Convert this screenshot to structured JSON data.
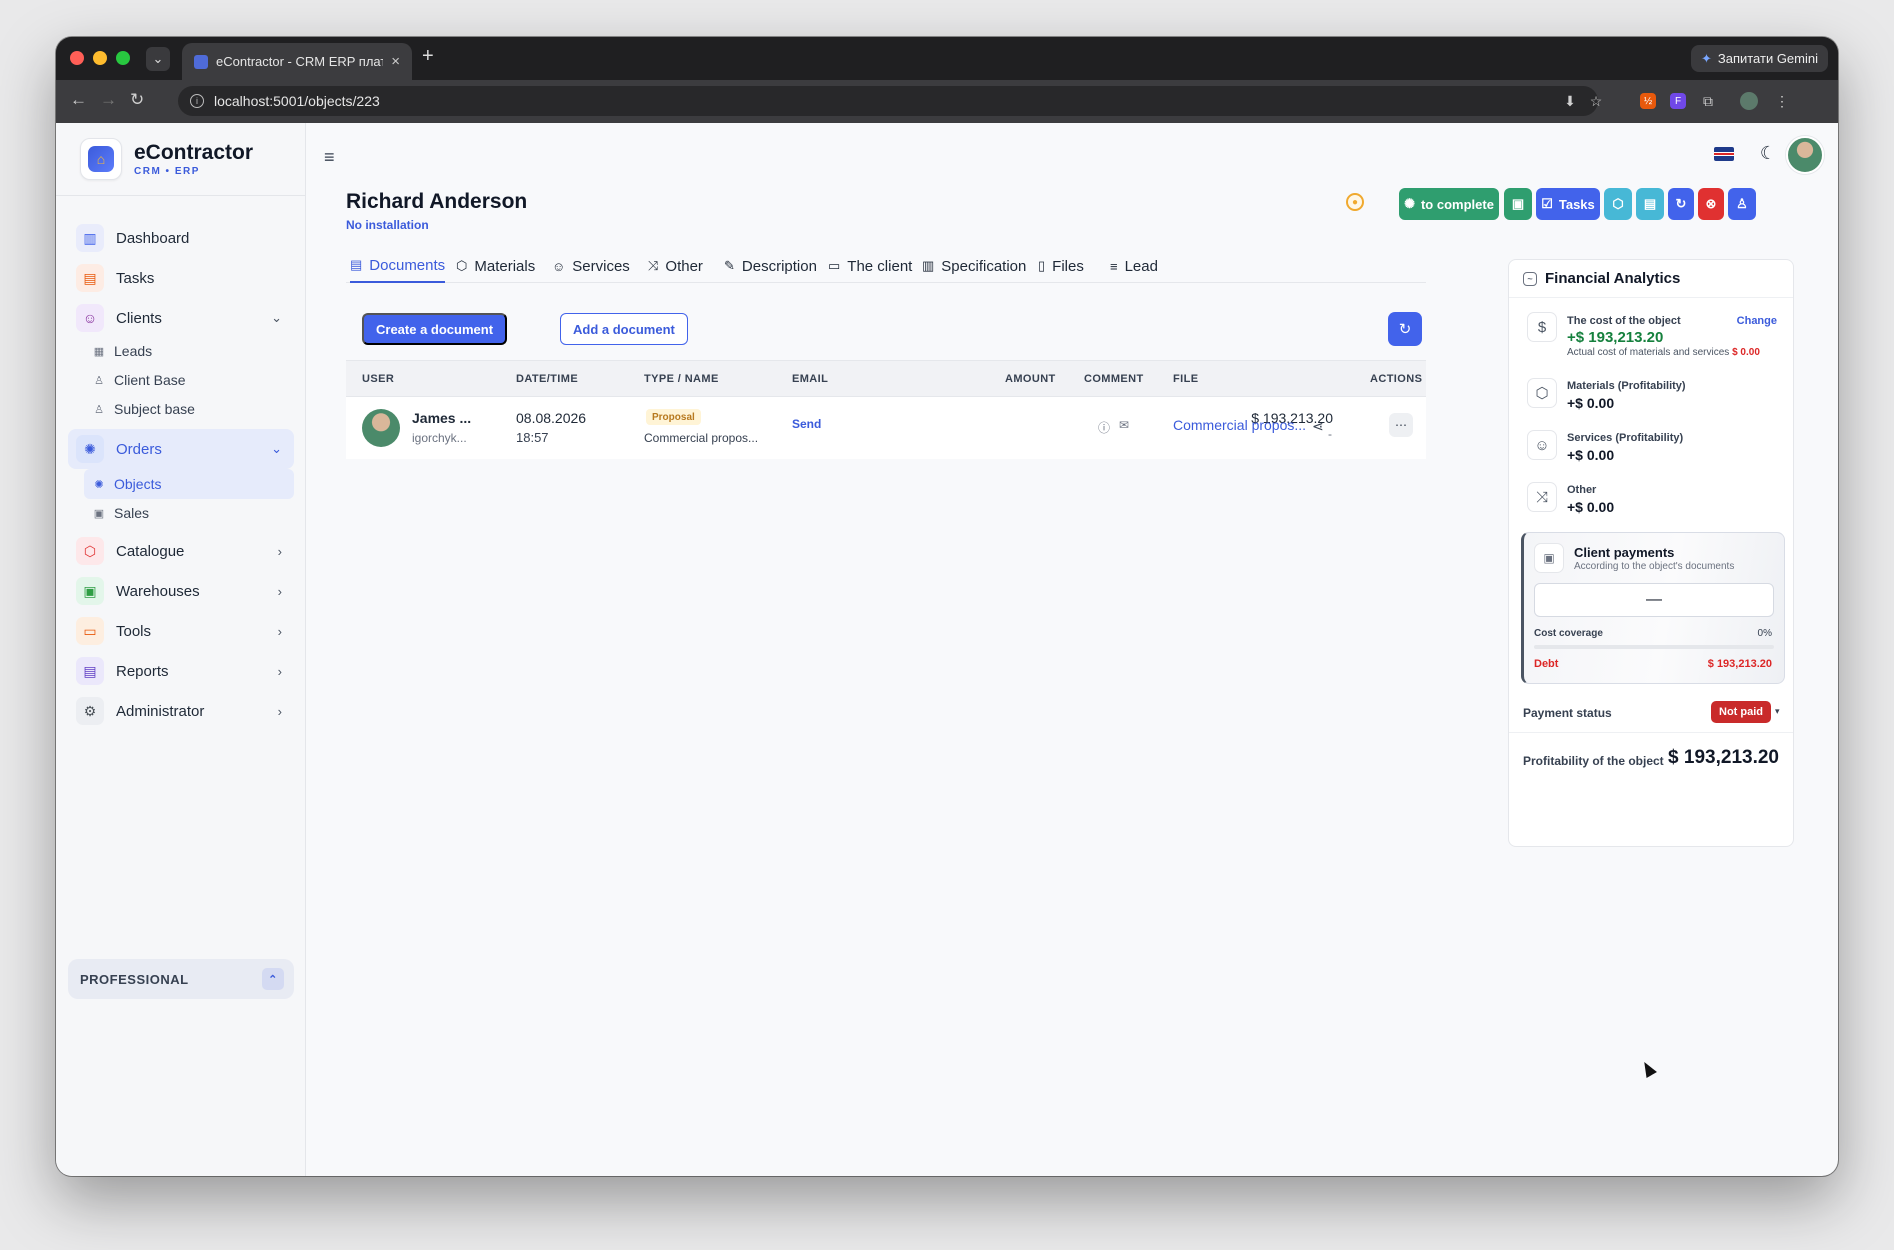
{
  "browser": {
    "tab_title": "eContractor - CRM ERP плат…",
    "url": "localhost:5001/objects/223",
    "gemini_label": "Запитати Gemini"
  },
  "brand": {
    "name": "eContractor",
    "sub": "CRM • ERP"
  },
  "sidebar": {
    "items": {
      "dashboard": "Dashboard",
      "tasks": "Tasks",
      "clients": "Clients",
      "leads": "Leads",
      "client_base": "Client Base",
      "subject_base": "Subject base",
      "orders": "Orders",
      "objects": "Objects",
      "sales": "Sales",
      "catalogue": "Catalogue",
      "warehouses": "Warehouses",
      "tools": "Tools",
      "reports": "Reports",
      "administrator": "Administrator"
    },
    "plan": "PROFESSIONAL"
  },
  "header": {
    "title": "Richard Anderson",
    "subtitle": "No installation",
    "complete_label": "to complete",
    "tasks_label": "Tasks"
  },
  "tabs": {
    "documents": "Documents",
    "materials": "Materials",
    "services": "Services",
    "other": "Other",
    "description": "Description",
    "client": "The client",
    "specification": "Specification",
    "files": "Files",
    "lead": "Lead"
  },
  "toolbar": {
    "create_label": "Create a document",
    "add_label": "Add a document"
  },
  "table": {
    "headers": {
      "user": "USER",
      "datetime": "DATE/TIME",
      "type": "TYPE / NAME",
      "email": "EMAIL",
      "amount": "AMOUNT",
      "comment": "COMMENT",
      "file": "FILE",
      "actions": "ACTIONS"
    },
    "row": {
      "user_name": "James ...",
      "user_email": "igorchyk...",
      "date": "08.08.2026",
      "time": "18:57",
      "badge": "Proposal",
      "doc_name": "Commercial propos...",
      "email_action": "Send",
      "amount": "$ 193,213.20",
      "amount_sub": "-",
      "file_name": "Commercial propos..."
    }
  },
  "financial": {
    "title": "Financial Analytics",
    "cost_label": "The cost of the object",
    "cost_value": "+$ 193,213.20",
    "change_label": "Change",
    "cost_note": "Actual cost of materials and services",
    "cost_note_value": "$ 0.00",
    "materials_label": "Materials (Profitability)",
    "materials_value": "+$ 0.00",
    "services_label": "Services (Profitability)",
    "services_value": "+$ 0.00",
    "other_label": "Other",
    "other_value": "+$ 0.00",
    "client_payments": {
      "title": "Client payments",
      "subtitle": "According to the object's documents",
      "value": "—",
      "coverage_label": "Cost coverage",
      "coverage_value": "0%",
      "coverage_fraction": 0,
      "debt_label": "Debt",
      "debt_value": "$ 193,213.20"
    },
    "payment_status_label": "Payment status",
    "payment_status_value": "Not paid",
    "profitability_label": "Profitability of the object",
    "profitability_value": "$ 193,213.20"
  },
  "colors": {
    "accent": "#4263eb",
    "complete_green": "#2f9e6f",
    "teal": "#47b8d6",
    "danger": "#e03131",
    "profit_green": "#15803d"
  }
}
